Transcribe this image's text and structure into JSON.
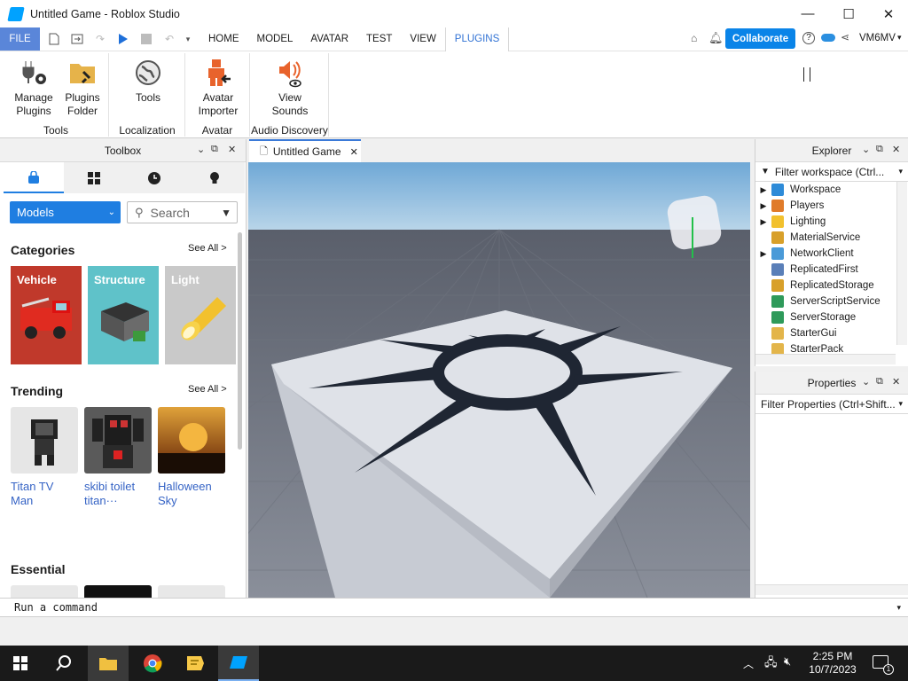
{
  "window": {
    "title": "Untitled Game - Roblox Studio",
    "minimize": "—",
    "maximize": "☐",
    "close": "✕"
  },
  "menubar": {
    "file": "FILE",
    "tabs": [
      "HOME",
      "MODEL",
      "AVATAR",
      "TEST",
      "VIEW",
      "PLUGINS"
    ],
    "collaborate": "Collaborate",
    "user": "VM6MV"
  },
  "ribbon": {
    "manage_plugins": "Manage\nPlugins",
    "plugins_folder": "Plugins\nFolder",
    "tools": "Tools",
    "avatar_importer": "Avatar\nImporter",
    "view_sounds": "View\nSounds",
    "groups": [
      "Tools",
      "Localization",
      "Avatar",
      "Audio Discovery"
    ]
  },
  "toolbox": {
    "title": "Toolbox",
    "dropdown": "Models",
    "search_placeholder": "Search",
    "categories_title": "Categories",
    "see_all": "See All >",
    "categories": [
      {
        "label": "Vehicle",
        "color": "#c0392b"
      },
      {
        "label": "Structure",
        "color": "#5fc2c9"
      },
      {
        "label": "Light",
        "color": "#c9c9c9"
      }
    ],
    "trending_title": "Trending",
    "trending": [
      {
        "label": "Titan TV Man"
      },
      {
        "label": "skibi toilet titan···"
      },
      {
        "label": "Halloween Sky"
      }
    ],
    "essential_title": "Essential"
  },
  "viewport": {
    "tab_label": "Untitled Game"
  },
  "explorer": {
    "title": "Explorer",
    "filter": "Filter workspace (Ctrl...",
    "items": [
      {
        "label": "Workspace",
        "expandable": true,
        "icon_color": "#2e8bd8"
      },
      {
        "label": "Players",
        "expandable": true,
        "icon_color": "#e07b2a"
      },
      {
        "label": "Lighting",
        "expandable": true,
        "icon_color": "#f2c12e"
      },
      {
        "label": "MaterialService",
        "expandable": false,
        "icon_color": "#d8a02a"
      },
      {
        "label": "NetworkClient",
        "expandable": true,
        "icon_color": "#4a9ad8"
      },
      {
        "label": "ReplicatedFirst",
        "expandable": false,
        "icon_color": "#5a7fb8"
      },
      {
        "label": "ReplicatedStorage",
        "expandable": false,
        "icon_color": "#d8a02a"
      },
      {
        "label": "ServerScriptService",
        "expandable": false,
        "icon_color": "#2e9a5a"
      },
      {
        "label": "ServerStorage",
        "expandable": false,
        "icon_color": "#2e9a5a"
      },
      {
        "label": "StarterGui",
        "expandable": false,
        "icon_color": "#e3b54a"
      },
      {
        "label": "StarterPack",
        "expandable": false,
        "icon_color": "#e3b54a"
      }
    ]
  },
  "properties": {
    "title": "Properties",
    "filter": "Filter Properties (Ctrl+Shift..."
  },
  "command": {
    "placeholder": "Run a command"
  },
  "taskbar": {
    "time": "2:25 PM",
    "date": "10/7/2023"
  }
}
